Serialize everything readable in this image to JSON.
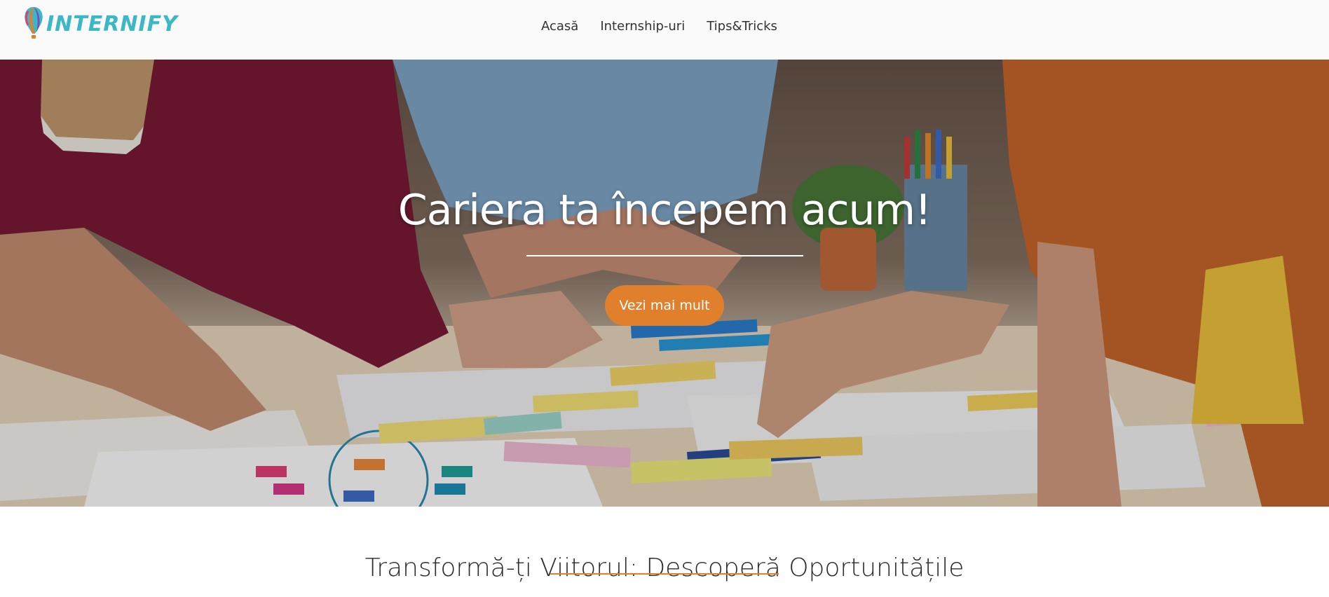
{
  "brand": {
    "name": "INTERNIFY",
    "color": "#3bb7c6",
    "logo_icon": "balloon-logo-icon"
  },
  "nav": {
    "items": [
      {
        "label": "Acasă"
      },
      {
        "label": "Internship-uri"
      },
      {
        "label": "Tips&Tricks"
      }
    ]
  },
  "hero": {
    "title": "Cariera ta începem acum!",
    "button_label": "Vezi mai mult",
    "button_color": "#e07f2c",
    "image": "team-collaborating-over-sticky-notes-photo"
  },
  "section": {
    "title": "Transformă-ți Viitorul: Descoperă Oportunitățile",
    "accent_color": "#e07f2c"
  }
}
